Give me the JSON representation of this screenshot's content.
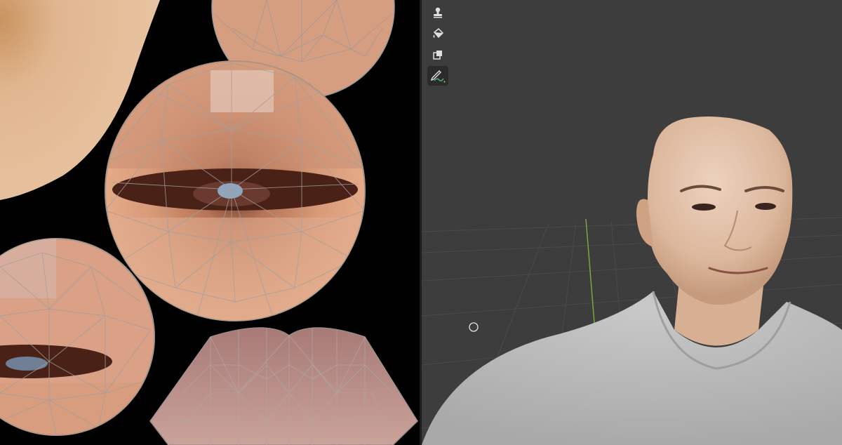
{
  "uv_editor": {
    "islands": [
      "skin-island",
      "eye-island-top",
      "eye-island-center",
      "eye-island-left",
      "mouth-island"
    ]
  },
  "viewport": {
    "tools": [
      {
        "name": "clone-stamp-icon",
        "active": false
      },
      {
        "name": "fill-bucket-icon",
        "active": false
      },
      {
        "name": "mask-layers-icon",
        "active": false
      },
      {
        "name": "annotate-pen-icon",
        "active": true
      }
    ],
    "cursor": "brush-circle-cursor"
  },
  "colors": {
    "viewport_bg": "#3d3d3d",
    "grid_line": "#4a4a4a",
    "y_axis": "#7aa83e",
    "uv_wire": "#9a9a9a",
    "skin": "#d9a984",
    "shirt": "#bdbdbd"
  }
}
